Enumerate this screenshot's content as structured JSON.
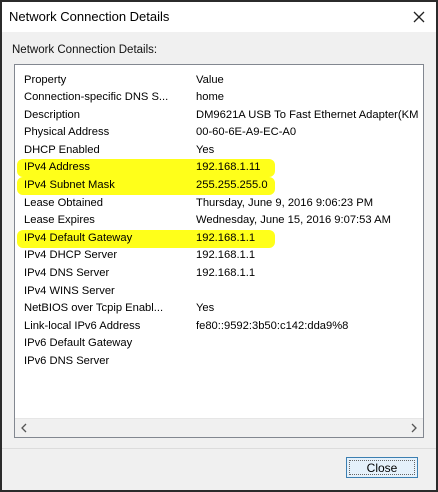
{
  "window": {
    "title": "Network Connection Details",
    "close_icon": "close-icon"
  },
  "section_label": "Network Connection Details:",
  "table": {
    "columns": [
      "Property",
      "Value"
    ],
    "rows": [
      {
        "property": "Connection-specific DNS S...",
        "value": "home",
        "highlighted": false
      },
      {
        "property": "Description",
        "value": "DM9621A USB To Fast Ethernet Adapter(KM",
        "highlighted": false
      },
      {
        "property": "Physical Address",
        "value": "00-60-6E-A9-EC-A0",
        "highlighted": false
      },
      {
        "property": "DHCP Enabled",
        "value": "Yes",
        "highlighted": false
      },
      {
        "property": "IPv4 Address",
        "value": "192.168.1.11",
        "highlighted": true
      },
      {
        "property": "IPv4 Subnet Mask",
        "value": "255.255.255.0",
        "highlighted": true
      },
      {
        "property": "Lease Obtained",
        "value": "Thursday, June 9, 2016 9:06:23 PM",
        "highlighted": false
      },
      {
        "property": "Lease Expires",
        "value": "Wednesday, June 15, 2016 9:07:53 AM",
        "highlighted": false
      },
      {
        "property": "IPv4 Default Gateway",
        "value": "192.168.1.1",
        "highlighted": true
      },
      {
        "property": "IPv4 DHCP Server",
        "value": "192.168.1.1",
        "highlighted": false
      },
      {
        "property": "IPv4 DNS Server",
        "value": "192.168.1.1",
        "highlighted": false
      },
      {
        "property": "IPv4 WINS Server",
        "value": "",
        "highlighted": false
      },
      {
        "property": "NetBIOS over Tcpip Enabl...",
        "value": "Yes",
        "highlighted": false
      },
      {
        "property": "Link-local IPv6 Address",
        "value": "fe80::9592:3b50:c142:dda9%8",
        "highlighted": false
      },
      {
        "property": "IPv6 Default Gateway",
        "value": "",
        "highlighted": false
      },
      {
        "property": "IPv6 DNS Server",
        "value": "",
        "highlighted": false
      }
    ]
  },
  "scrollbar": {
    "left_icon": "chevron-left-icon",
    "right_icon": "chevron-right-icon"
  },
  "buttons": {
    "close_label": "Close"
  },
  "colors": {
    "highlight": "#ffff1a",
    "button_border": "#3c7fb1"
  }
}
